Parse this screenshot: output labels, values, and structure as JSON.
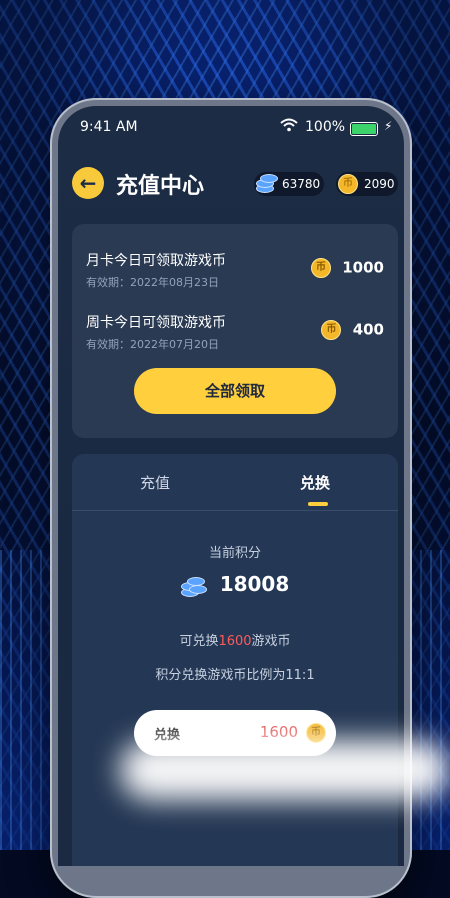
{
  "status": {
    "time": "9:41 AM",
    "battery": "100%"
  },
  "header": {
    "title": "充值中心",
    "gems": "63780",
    "coins": "2090",
    "coin_glyph": "币"
  },
  "rewards": [
    {
      "name": "月卡今日可领取游戏币",
      "expiry": "有效期：2022年08月23日",
      "amount": "1000"
    },
    {
      "name": "周卡今日可领取游戏币",
      "expiry": "有效期：2022年07月20日",
      "amount": "400"
    }
  ],
  "claim_all_label": "全部领取",
  "tabs": [
    {
      "label": "充值"
    },
    {
      "label": "兑换"
    }
  ],
  "active_tab": 1,
  "exchange": {
    "current_label": "当前积分",
    "points": "18008",
    "note_prefix": "可兑换",
    "note_value": "1600",
    "note_suffix": "游戏币",
    "ratio_text": "积分兑换游戏币比例为11:1",
    "input_label": "兑换",
    "input_value": "1600"
  },
  "colors": {
    "accent": "#ffcf3e",
    "highlight": "#ff5a5a",
    "panel": "#243754"
  }
}
